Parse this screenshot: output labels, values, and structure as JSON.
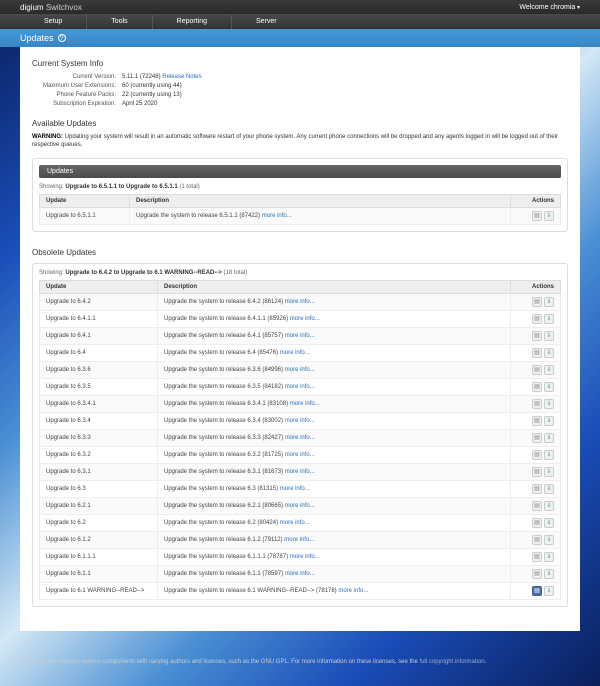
{
  "topbar": {
    "brand1": "digium",
    "brand2": "Switchvox",
    "welcome": "Welcome chromia"
  },
  "nav": [
    "Setup",
    "Tools",
    "Reporting",
    "Server"
  ],
  "page_title": "Updates",
  "sys_info": {
    "title": "Current System Info",
    "rows": [
      {
        "label": "Current Version:",
        "value": "5.11.1 (72248) ",
        "link": "Release Notes"
      },
      {
        "label": "Maximum User Extensions:",
        "value": "60 (currently using 44)"
      },
      {
        "label": "Phone Feature Packs:",
        "value": "22 (currently using 13)"
      },
      {
        "label": "Subscription Expiration:",
        "value": "April 25 2020"
      }
    ]
  },
  "available": {
    "title": "Available Updates",
    "warning_label": "WARNING:",
    "warning_text": " Updating your system will result in an automatic software restart of your phone system. Any current phone connections will be dropped and any agents logged in will be logged out of their respective queues.",
    "panel_title": "Updates",
    "showing_prefix": "Showing:",
    "showing_bold": "Upgrade to 6.5.1.1 to Upgrade to 6.5.1.1",
    "showing_suffix": "(1 total)",
    "cols": {
      "update": "Update",
      "description": "Description",
      "actions": "Actions"
    },
    "rows": [
      {
        "update": "Upgrade to 6.5.1.1",
        "desc": "Upgrade the system to release 6.5.1.1 (87422)",
        "more": "more info..."
      }
    ]
  },
  "obsolete": {
    "title": "Obsolete Updates",
    "showing_prefix": "Showing:",
    "showing_bold": "Upgrade to 6.4.2 to Upgrade to 6.1 WARNING--READ-->",
    "showing_suffix": "(18 total)",
    "cols": {
      "update": "Update",
      "description": "Description",
      "actions": "Actions"
    },
    "rows": [
      {
        "update": "Upgrade to 6.4.2",
        "desc": "Upgrade the system to release 6.4.2 (86124)",
        "more": "more info..."
      },
      {
        "update": "Upgrade to 6.4.1.1",
        "desc": "Upgrade the system to release 6.4.1.1 (85926)",
        "more": "more info..."
      },
      {
        "update": "Upgrade to 6.4.1",
        "desc": "Upgrade the system to release 6.4.1 (85757)",
        "more": "more info..."
      },
      {
        "update": "Upgrade to 6.4",
        "desc": "Upgrade the system to release 6.4 (85476)",
        "more": "more info..."
      },
      {
        "update": "Upgrade to 6.3.6",
        "desc": "Upgrade the system to release 6.3.6 (84996)",
        "more": "more info..."
      },
      {
        "update": "Upgrade to 6.3.5",
        "desc": "Upgrade the system to release 6.3.5 (84182)",
        "more": "more info..."
      },
      {
        "update": "Upgrade to 6.3.4.1",
        "desc": "Upgrade the system to release 6.3.4.1 (83108)",
        "more": "more info..."
      },
      {
        "update": "Upgrade to 6.3.4",
        "desc": "Upgrade the system to release 6.3.4 (83002)",
        "more": "more info..."
      },
      {
        "update": "Upgrade to 6.3.3",
        "desc": "Upgrade the system to release 6.3.3 (82427)",
        "more": "more info..."
      },
      {
        "update": "Upgrade to 6.3.2",
        "desc": "Upgrade the system to release 6.3.2 (81725)",
        "more": "more info..."
      },
      {
        "update": "Upgrade to 6.3.1",
        "desc": "Upgrade the system to release 6.3.1 (81673)",
        "more": "more info..."
      },
      {
        "update": "Upgrade to 6.3",
        "desc": "Upgrade the system to release 6.3 (81315)",
        "more": "more info..."
      },
      {
        "update": "Upgrade to 6.2.1",
        "desc": "Upgrade the system to release 6.2.1 (80665)",
        "more": "more info..."
      },
      {
        "update": "Upgrade to 6.2",
        "desc": "Upgrade the system to release 6.2 (80424)",
        "more": "more info..."
      },
      {
        "update": "Upgrade to 6.1.2",
        "desc": "Upgrade the system to release 6.1.2 (79112)",
        "more": "more info..."
      },
      {
        "update": "Upgrade to 6.1.1.1",
        "desc": "Upgrade the system to release 6.1.1.1 (78787)",
        "more": "more info..."
      },
      {
        "update": "Upgrade to 6.1.1",
        "desc": "Upgrade the system to release 6.1.1 (78597)",
        "more": "more info..."
      },
      {
        "update": "Upgrade to 6.1 WARNING--READ-->",
        "desc": "Upgrade the system to release 6.1 WARNING--READ--> (78178)",
        "more": "more info...",
        "special": true
      }
    ]
  },
  "footer": {
    "text1": "This software contains various components with varying authors and licenses, such as the GNU GPL. For more information on these licenses, see the ",
    "link": "full copyright information",
    "text2": "."
  }
}
